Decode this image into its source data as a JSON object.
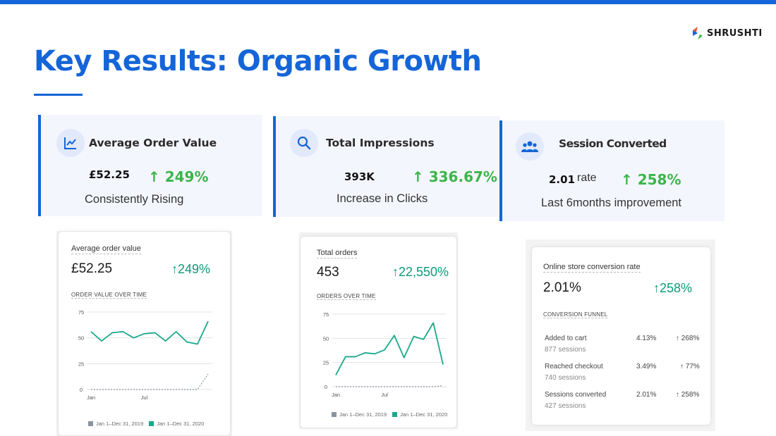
{
  "brand": {
    "name": "SHRUSHTI"
  },
  "slide": {
    "title": "Key Results: Organic Growth"
  },
  "kpis": [
    {
      "icon": "line-chart-icon",
      "title": "Average  Order Value",
      "value": "£52.25",
      "unit": "",
      "growth": "↑ 249%",
      "subtitle": "Consistently Rising"
    },
    {
      "icon": "search-icon",
      "title": "Total Impressions",
      "value": "393K",
      "unit": "",
      "growth": "↑ 336.67%",
      "subtitle": "Increase in Clicks"
    },
    {
      "icon": "users-icon",
      "title": "Session Converted",
      "value": "2.01",
      "unit": "rate",
      "growth": "↑ 258%",
      "subtitle": "Last 6months improvement"
    }
  ],
  "cards": {
    "aov": {
      "label": "Average order value",
      "value": "£52.25",
      "growth": "↑249%",
      "section": "ORDER VALUE OVER TIME",
      "legend": [
        "Jan 1–Dec 31, 2019",
        "Jan 1–Dec 31, 2020"
      ]
    },
    "orders": {
      "label": "Total orders",
      "value": "453",
      "growth": "↑22,550%",
      "section": "ORDERS OVER TIME",
      "legend": [
        "Jan 1–Dec 31, 2019",
        "Jan 1–Dec 31, 2020"
      ]
    },
    "conversion": {
      "label": "Online store conversion rate",
      "value": "2.01%",
      "growth": "↑258%",
      "section": "CONVERSION FUNNEL",
      "funnel": [
        {
          "name": "Added to cart",
          "sessions": "877 sessions",
          "rate": "4.13%",
          "growth": "↑ 268%"
        },
        {
          "name": "Reached checkout",
          "sessions": "740 sessions",
          "rate": "3.49%",
          "growth": "↑ 77%"
        },
        {
          "name": "Sessions converted",
          "sessions": "427 sessions",
          "rate": "2.01%",
          "growth": "↑ 258%"
        }
      ]
    }
  },
  "colors": {
    "accent": "#1565d8",
    "growth": "#3bb54a",
    "series_current": "#1aa88a",
    "series_previous": "#8a93a3"
  },
  "chart_data": [
    {
      "type": "line",
      "x_ticks": [
        "Jan",
        "Jul"
      ],
      "y_ticks": [
        "75",
        "50",
        "25",
        "0"
      ],
      "ylim": [
        0,
        75
      ],
      "series": [
        {
          "name": "Jan 1–Dec 31, 2020",
          "values": [
            56,
            47,
            55,
            56,
            50,
            54,
            55,
            47,
            56,
            46,
            44,
            66
          ]
        },
        {
          "name": "Jan 1–Dec 31, 2019",
          "values": [
            0,
            0,
            0,
            0,
            0,
            0,
            0,
            0,
            0,
            0,
            0,
            15
          ]
        }
      ]
    },
    {
      "type": "line",
      "x_ticks": [
        "Jan",
        "Jul"
      ],
      "y_ticks": [
        "75",
        "50",
        "25",
        "0"
      ],
      "ylim": [
        0,
        75
      ],
      "series": [
        {
          "name": "Jan 1–Dec 31, 2020",
          "values": [
            12,
            31,
            31,
            35,
            34,
            38,
            53,
            30,
            52,
            49,
            66,
            23
          ]
        },
        {
          "name": "Jan 1–Dec 31, 2019",
          "values": [
            0,
            0,
            0,
            0,
            0,
            0,
            0,
            0,
            0,
            0,
            0,
            1
          ]
        }
      ]
    }
  ]
}
